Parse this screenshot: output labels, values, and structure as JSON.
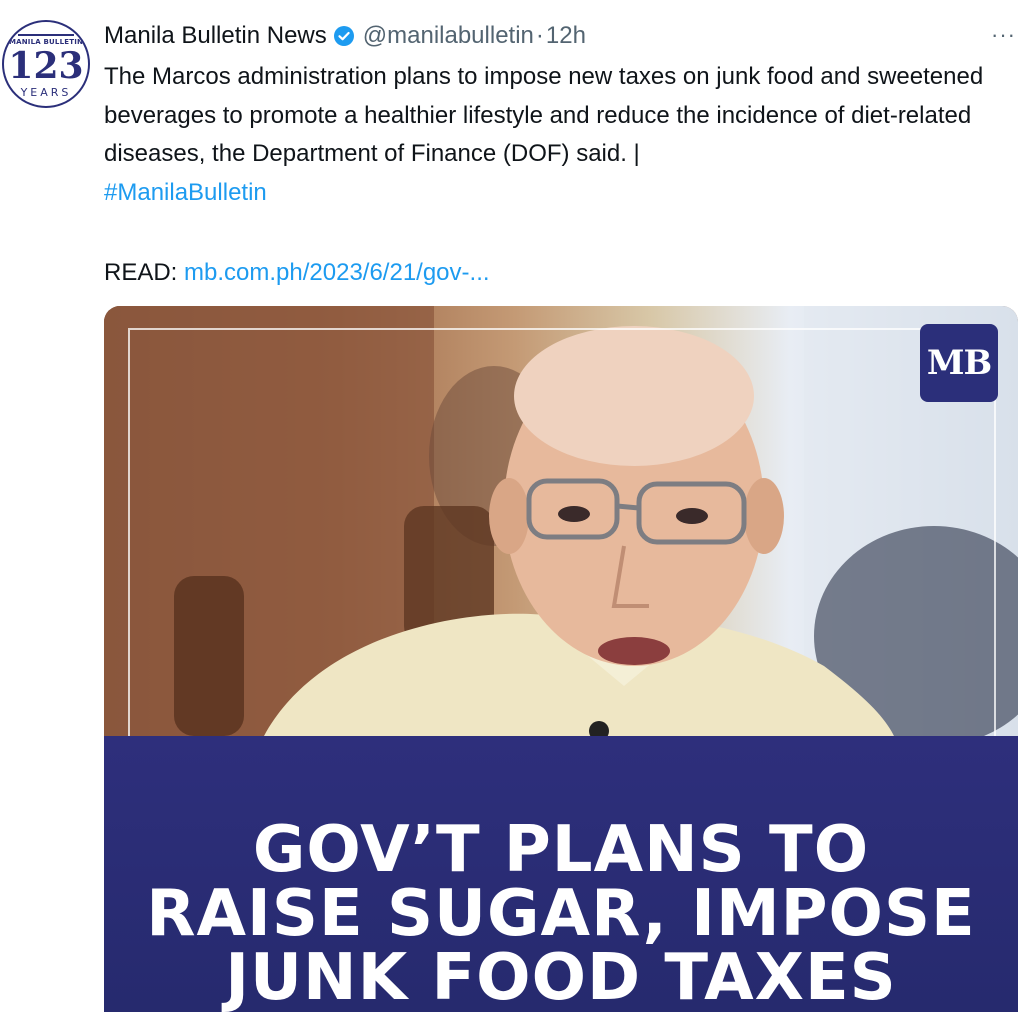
{
  "account": {
    "display_name": "Manila Bulletin News",
    "handle": "@manilabulletin",
    "separator": "·",
    "time": "12h",
    "verified_icon": "verified-badge-icon",
    "avatar": {
      "brand": "MANILA BULLETIN",
      "number": "123",
      "subtitle": "YEARS"
    }
  },
  "tweet": {
    "text": "The Marcos administration plans to impose new taxes on junk food and sweetened beverages to promote a healthier lifestyle and reduce the incidence of diet-related diseases, the Department of Finance (DOF) said. |",
    "hashtag": "#ManilaBulletin",
    "read_label": "READ: ",
    "link": "mb.com.ph/2023/6/21/gov-..."
  },
  "more_menu": "···",
  "media": {
    "logo": "MB",
    "headline_lines": [
      "GOV’T PLANS TO",
      "RAISE SUGAR, IMPOSE",
      "JUNK FOOD TAXES"
    ]
  },
  "colors": {
    "link": "#1d9bf0",
    "secondary_text": "#536471",
    "brand_navy": "#2b2f7a"
  }
}
